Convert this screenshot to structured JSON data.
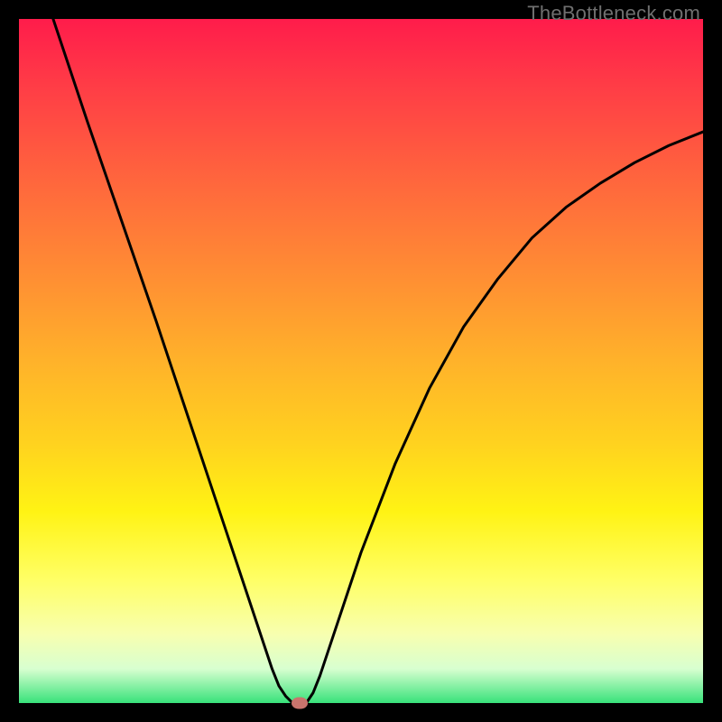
{
  "watermark": "TheBottleneck.com",
  "chart_data": {
    "type": "line",
    "title": "",
    "xlabel": "",
    "ylabel": "",
    "xlim": [
      0,
      100
    ],
    "ylim": [
      0,
      100
    ],
    "grid": false,
    "legend": false,
    "series": [
      {
        "name": "bottleneck-curve",
        "x": [
          5,
          10,
          15,
          20,
          25,
          30,
          32,
          34,
          36,
          37,
          38,
          39,
          40,
          41,
          42,
          43,
          44,
          46,
          50,
          55,
          60,
          65,
          70,
          75,
          80,
          85,
          90,
          95,
          100
        ],
        "y": [
          100,
          85,
          70.5,
          56,
          41,
          26,
          20,
          14,
          8,
          5,
          2.5,
          1,
          0,
          0,
          0,
          1.5,
          4,
          10,
          22,
          35,
          46,
          55,
          62,
          68,
          72.5,
          76,
          79,
          81.5,
          83.5
        ]
      }
    ],
    "marker": {
      "x": 41,
      "y": 0,
      "color": "#c9746d"
    },
    "gradient_colors": {
      "top": "#ff1c4b",
      "mid_upper": "#ff8f33",
      "mid": "#ffd21f",
      "mid_lower": "#ffff66",
      "bottom": "#38e27a"
    }
  }
}
